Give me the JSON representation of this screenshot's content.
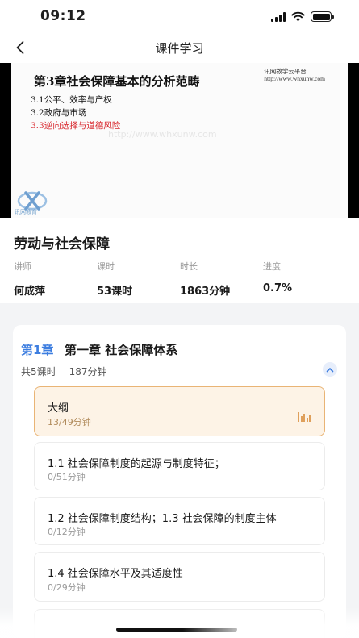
{
  "status_bar": {
    "time": "09:12"
  },
  "nav": {
    "title": "课件学习"
  },
  "slide": {
    "title": "第3章社会保障基本的分析范畴",
    "watermark_line1": "讯网教学云平台",
    "watermark_line2": "http://www.whxunw.com",
    "items": [
      "3.1公平、效率与产权",
      "3.2政府与市场",
      "3.3逆向选择与道德风险"
    ],
    "faint_text": "http://www.whxunw.com",
    "logo_text": "讯网教育"
  },
  "course": {
    "title": "劳动与社会保障",
    "stats": [
      {
        "label": "讲师",
        "value": "何成萍"
      },
      {
        "label": "课时",
        "value": "53课时"
      },
      {
        "label": "时长",
        "value": "1863分钟"
      },
      {
        "label": "进度",
        "value": "0.7%"
      }
    ]
  },
  "chapter": {
    "number": "第1章",
    "title": "第一章  社会保障体系",
    "lessons_count": "共5课时",
    "duration": "187分钟",
    "lessons": [
      {
        "title": "大纲",
        "progress": "13/49分钟"
      },
      {
        "title": "1.1 社会保障制度的起源与制度特征；",
        "progress": "0/51分钟"
      },
      {
        "title": "1.2 社会保障制度结构；1.3 社会保障的制度主体",
        "progress": "0/12分钟"
      },
      {
        "title": "1.4 社会保障水平及其适度性",
        "progress": "0/29分钟"
      }
    ]
  },
  "colors": {
    "accent_blue": "#3d7ee0",
    "active_bg": "#fdf3e6",
    "active_border": "#e9b475",
    "slide_red": "#d8262c"
  },
  "icons": [
    "signal-icon",
    "wifi-icon",
    "battery-icon",
    "back-arrow-icon",
    "chevron-up-icon",
    "playing-bars-icon"
  ]
}
